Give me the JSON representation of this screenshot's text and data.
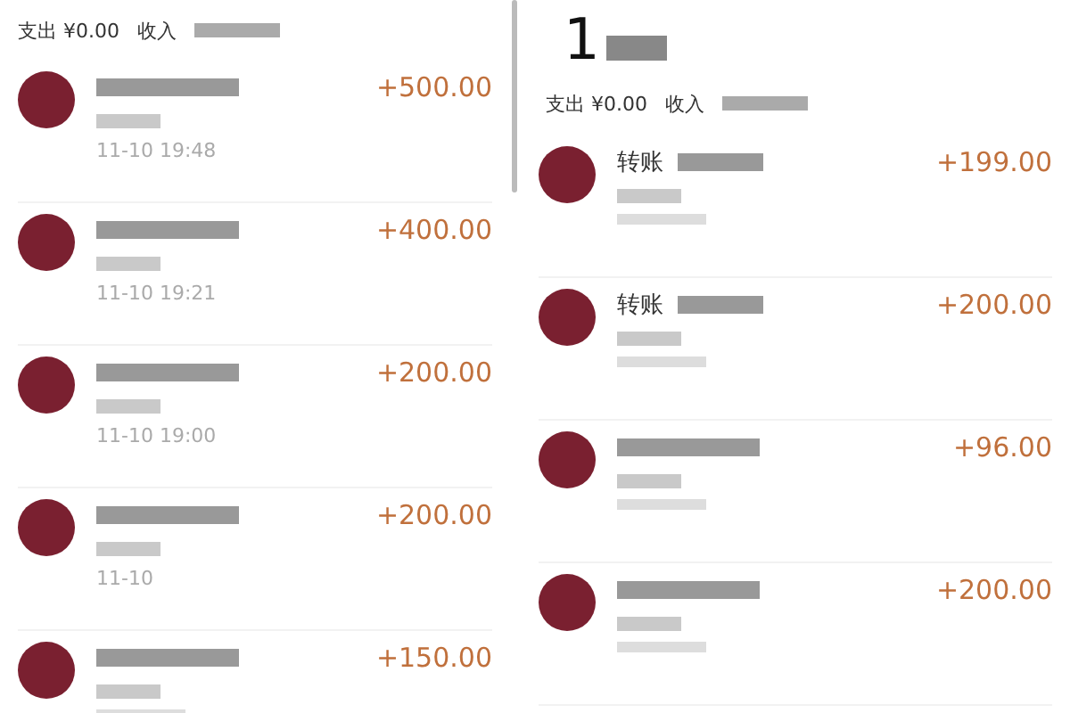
{
  "panels": [
    {
      "summary": {
        "expense": "支出 ¥0.00",
        "income_label": "收入"
      },
      "records": [
        {
          "amount": "+500.00",
          "time": "11-10  19:48"
        },
        {
          "amount": "+400.00",
          "time": "11-10  19:21"
        },
        {
          "amount": "+200.00",
          "time": "11-10  19:00"
        },
        {
          "amount": "+200.00",
          "time": "11-10"
        },
        {
          "amount": "+150.00"
        }
      ]
    },
    {
      "heading": "1",
      "summary": {
        "expense": "支出 ¥0.00",
        "income_label": "收入"
      },
      "records": [
        {
          "title": "转账",
          "amount": "+199.00"
        },
        {
          "title": "转账",
          "amount": "+200.00"
        },
        {
          "amount": "+96.00"
        },
        {
          "amount": "+200.00"
        }
      ]
    }
  ]
}
